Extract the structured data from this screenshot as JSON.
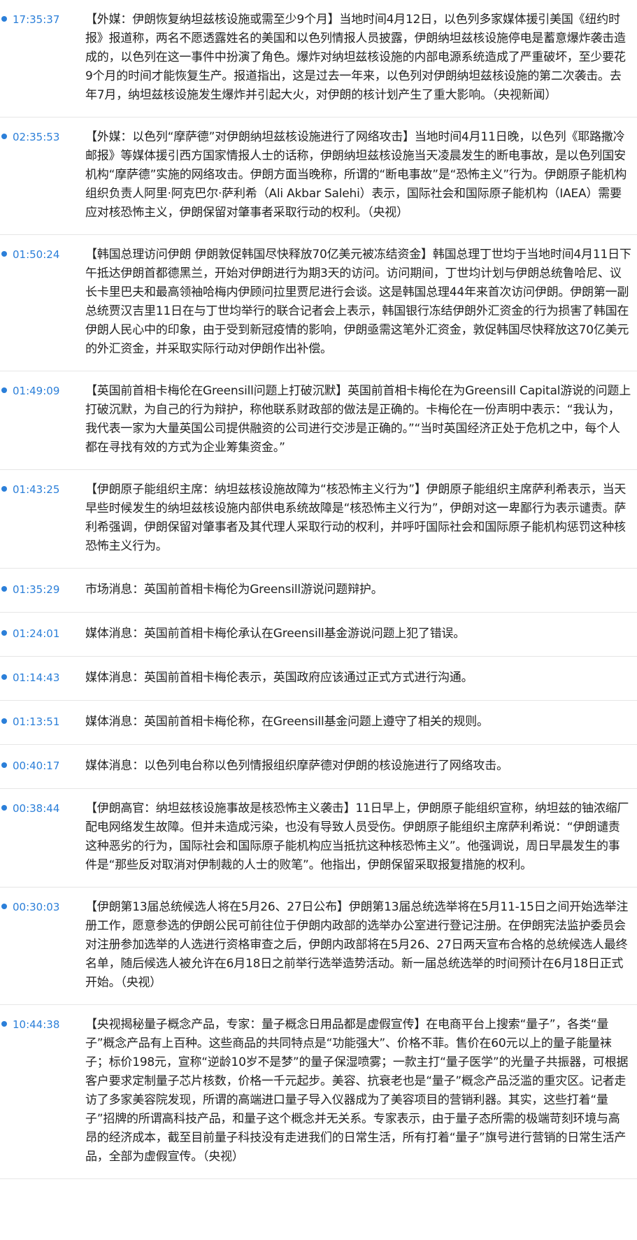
{
  "colors": {
    "accent": "#2b7fd9",
    "text": "#222222",
    "divider": "#e6e6e6"
  },
  "news": [
    {
      "time": "17:35:37",
      "text": "【外媒：伊朗恢复纳坦兹核设施或需至少9个月】当地时间4月12日，以色列多家媒体援引美国《纽约时报》报道称，两名不愿透露姓名的美国和以色列情报人员披露，伊朗纳坦兹核设施停电是蓄意爆炸袭击造成的，以色列在这一事件中扮演了角色。爆炸对纳坦兹核设施的内部电源系统造成了严重破坏，至少要花9个月的时间才能恢复生产。报道指出，这是过去一年来，以色列对伊朗纳坦兹核设施的第二次袭击。去年7月，纳坦兹核设施发生爆炸并引起大火，对伊朗的核计划产生了重大影响。（央视新闻）"
    },
    {
      "time": "02:35:53",
      "text": "【外媒：以色列“摩萨德”对伊朗纳坦兹核设施进行了网络攻击】当地时间4月11日晚，以色列《耶路撒冷邮报》等媒体援引西方国家情报人士的话称，伊朗纳坦兹核设施当天凌晨发生的断电事故，是以色列国安机构“摩萨德”实施的网络攻击。伊朗方面当晚称，所谓的“断电事故”是“恐怖主义”行为。伊朗原子能机构组织负责人阿里·阿克巴尔·萨利希（Ali Akbar Salehi）表示，国际社会和国际原子能机构（IAEA）需要应对核恐怖主义，伊朗保留对肇事者采取行动的权利。（央视）"
    },
    {
      "time": "01:50:24",
      "text": "【韩国总理访问伊朗 伊朗敦促韩国尽快释放70亿美元被冻结资金】韩国总理丁世均于当地时间4月11日下午抵达伊朗首都德黑兰，开始对伊朗进行为期3天的访问。访问期间，丁世均计划与伊朗总统鲁哈尼、议长卡里巴夫和最高领袖哈梅内伊顾问拉里贾尼进行会谈。这是韩国总理44年来首次访问伊朗。伊朗第一副总统贾汉吉里11日在与丁世均举行的联合记者会上表示，韩国银行冻结伊朗外汇资金的行为损害了韩国在伊朗人民心中的印象，由于受到新冠疫情的影响，伊朗亟需这笔外汇资金，敦促韩国尽快释放这70亿美元的外汇资金，并采取实际行动对伊朗作出补偿。"
    },
    {
      "time": "01:49:09",
      "text": "【英国前首相卡梅伦在Greensill问题上打破沉默】英国前首相卡梅伦在为Greensill Capital游说的问题上打破沉默，为自己的行为辩护，称他联系财政部的做法是正确的。卡梅伦在一份声明中表示：“我认为，我代表一家为大量英国公司提供融资的公司进行交涉是正确的。”“当时英国经济正处于危机之中，每个人都在寻找有效的方式为企业筹集资金。”"
    },
    {
      "time": "01:43:25",
      "text": "【伊朗原子能组织主席：纳坦兹核设施故障为“核恐怖主义行为”】伊朗原子能组织主席萨利希表示，当天早些时候发生的纳坦兹核设施内部供电系统故障是“核恐怖主义行为”，伊朗对这一卑鄙行为表示谴责。萨利希强调，伊朗保留对肇事者及其代理人采取行动的权利，并呼吁国际社会和国际原子能机构惩罚这种核恐怖主义行为。"
    },
    {
      "time": "01:35:29",
      "text": "市场消息：英国前首相卡梅伦为Greensill游说问题辩护。"
    },
    {
      "time": "01:24:01",
      "text": "媒体消息：英国前首相卡梅伦承认在Greensill基金游说问题上犯了错误。"
    },
    {
      "time": "01:14:43",
      "text": "媒体消息：英国前首相卡梅伦表示，英国政府应该通过正式方式进行沟通。"
    },
    {
      "time": "01:13:51",
      "text": "媒体消息：英国前首相卡梅伦称，在Greensill基金问题上遵守了相关的规则。"
    },
    {
      "time": "00:40:17",
      "text": "媒体消息：以色列电台称以色列情报组织摩萨德对伊朗的核设施进行了网络攻击。"
    },
    {
      "time": "00:38:44",
      "text": "【伊朗高官：纳坦兹核设施事故是核恐怖主义袭击】11日早上，伊朗原子能组织宣称，纳坦兹的铀浓缩厂配电网络发生故障。但并未造成污染，也没有导致人员受伤。伊朗原子能组织主席萨利希说：“伊朗谴责这种恶劣的行为，国际社会和国际原子能机构应当抵抗这种核恐怖主义”。他强调说，周日早晨发生的事件是“那些反对取消对伊制裁的人士的败笔”。他指出，伊朗保留采取报复措施的权利。"
    },
    {
      "time": "00:30:03",
      "text": "【伊朗第13届总统候选人将在5月26、27日公布】伊朗第13届总统选举将在5月11-15日之间开始选举注册工作，愿意参选的伊朗公民可前往位于伊朗内政部的选举办公室进行登记注册。在伊朗宪法监护委员会对注册参加选举的人选进行资格审查之后，伊朗内政部将在5月26、27日两天宣布合格的总统候选人最终名单，随后候选人被允许在6月18日之前举行选举造势活动。新一届总统选举的时间预计在6月18日正式开始。（央视）"
    },
    {
      "time": "10:44:38",
      "text": "【央视揭秘量子概念产品，专家：量子概念日用品都是虚假宣传】在电商平台上搜索“量子”，各类“量子”概念产品有上百种。这些商品的共同特点是“功能强大”、价格不菲。售价在60元以上的量子能量袜子；标价198元，宣称“逆龄10岁不是梦”的量子保湿喷雾；一款主打“量子医学”的光量子共振器，可根据客户要求定制量子芯片核数，价格一千元起步。美容、抗衰老也是“量子”概念产品泛滥的重灾区。记者走访了多家美容院发现，所谓的高端进口量子导入仪器成为了美容项目的营销利器。其实，这些打着“量子”招牌的所谓高科技产品，和量子这个概念并无关系。专家表示，由于量子态所需的极端苛刻环境与高昂的经济成本，截至目前量子科技没有走进我们的日常生活，所有打着“量子”旗号进行营销的日常生活产品，全部为虚假宣传。（央视）"
    }
  ]
}
